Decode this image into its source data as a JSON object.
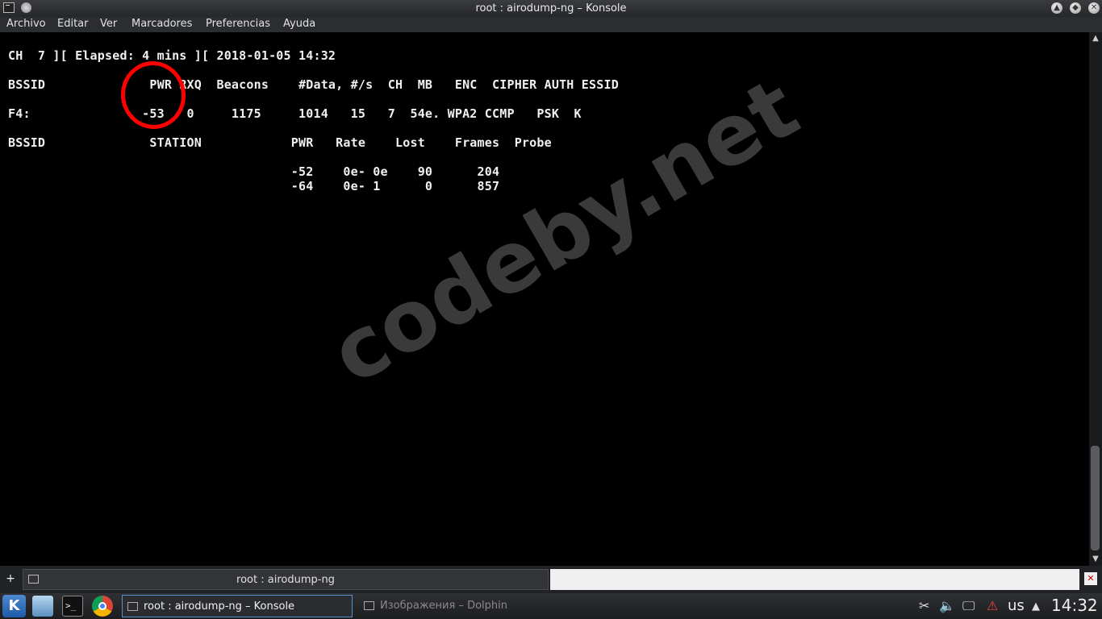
{
  "window": {
    "title": "root : airodump-ng – Konsole",
    "buttons": [
      "▲",
      "◆",
      "✕"
    ]
  },
  "menu": [
    "Archivo",
    "Editar",
    "Ver",
    "Marcadores",
    "Preferencias",
    "Ayuda"
  ],
  "terminal": {
    "lines": [
      "CH  7 ][ Elapsed: 4 mins ][ 2018-01-05 14:32",
      "BSSID              PWR RXQ  Beacons    #Data, #/s  CH  MB   ENC  CIPHER AUTH ESSID",
      "F4:               -53   0     1175     1014   15   7  54e. WPA2 CCMP   PSK  K",
      "BSSID              STATION            PWR   Rate    Lost    Frames  Probe",
      "                                      -52    0e- 0e    90      204",
      "                                      -64    0e- 1      0      857"
    ],
    "annotation": "red circle highlighting PWR column value -53",
    "watermark": "codeby.net"
  },
  "tabbar": {
    "new_tab": "+",
    "tab_label": "root : airodump-ng",
    "close_tab": "✕"
  },
  "taskbar": {
    "kmenu": "K",
    "terminal_launcher": ">_",
    "tasks": [
      {
        "label": "root : airodump-ng – Konsole",
        "active": true
      },
      {
        "label": "Изображения – Dolphin",
        "active": false
      }
    ],
    "tray_icons": [
      "scissors-icon",
      "volume-icon",
      "network-icon",
      "network-disconnected-icon"
    ],
    "tray_glyphs": [
      "✂",
      "🔈",
      "🖵",
      "⚠"
    ],
    "keyboard_layout": "us",
    "tray_arrow": "▲",
    "clock": "14:32"
  },
  "colors": {
    "annotation": "#ff0000",
    "watermark": "#3a3a3a",
    "terminal_bg": "#000000",
    "terminal_fg": "#f0f0f0"
  }
}
